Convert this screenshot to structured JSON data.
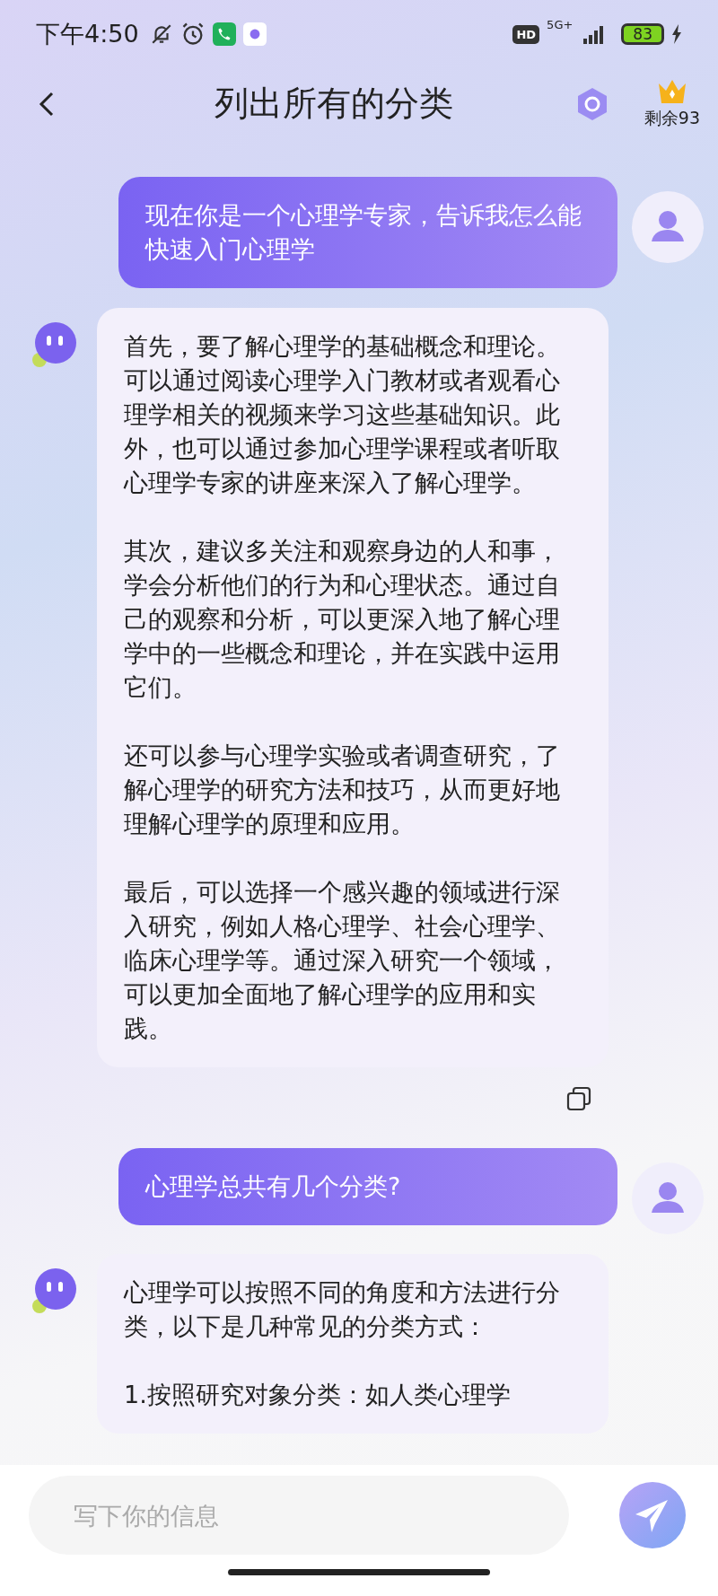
{
  "status_bar": {
    "time": "下午4:50",
    "hd_badge": "HD",
    "network": "5G+",
    "battery": "83"
  },
  "header": {
    "title": "列出所有的分类",
    "remaining": "剩余93"
  },
  "messages": [
    {
      "kind": "user",
      "paragraphs": [
        "现在你是一个心理学专家，告诉我怎么能快速入门心理学"
      ],
      "copy_button": false
    },
    {
      "kind": "assistant",
      "paragraphs": [
        "首先，要了解心理学的基础概念和理论。可以通过阅读心理学入门教材或者观看心理学相关的视频来学习这些基础知识。此外，也可以通过参加心理学课程或者听取心理学专家的讲座来深入了解心理学。",
        "其次，建议多关注和观察身边的人和事，学会分析他们的行为和心理状态。通过自己的观察和分析，可以更深入地了解心理学中的一些概念和理论，并在实践中运用它们。",
        "还可以参与心理学实验或者调查研究，了解心理学的研究方法和技巧，从而更好地理解心理学的原理和应用。",
        "最后，可以选择一个感兴趣的领域进行深入研究，例如人格心理学、社会心理学、临床心理学等。通过深入研究一个领域，可以更加全面地了解心理学的应用和实践。"
      ],
      "copy_button": true
    },
    {
      "kind": "user",
      "paragraphs": [
        "心理学总共有几个分类?"
      ],
      "copy_button": false
    },
    {
      "kind": "assistant",
      "paragraphs": [
        "心理学可以按照不同的角度和方法进行分类，以下是几种常见的分类方式：",
        "1.按照研究对象分类：如人类心理学"
      ],
      "copy_button": false
    }
  ],
  "input": {
    "placeholder": "写下你的信息"
  }
}
